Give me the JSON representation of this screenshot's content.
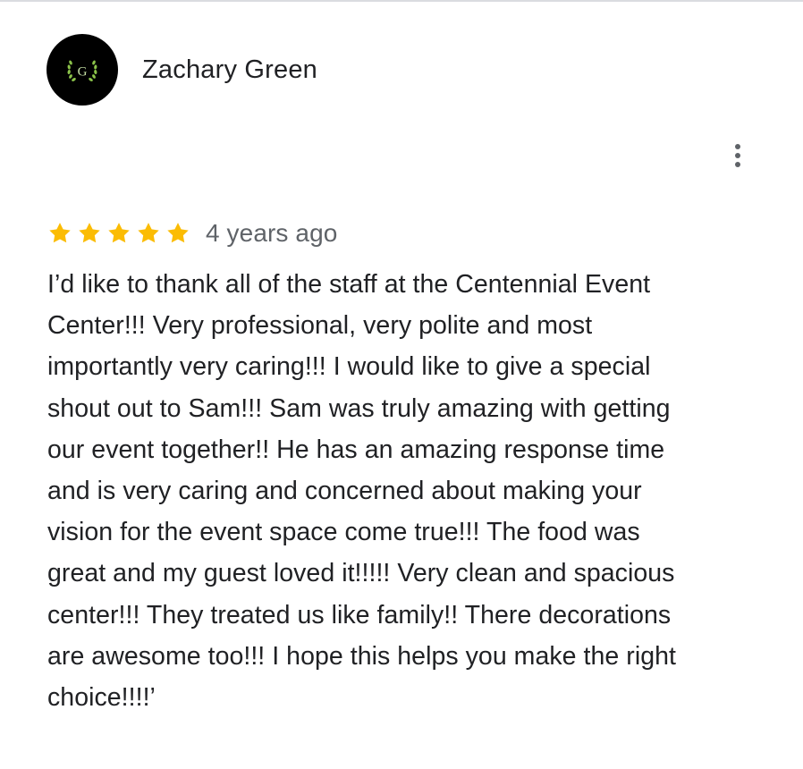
{
  "reviewer": {
    "name": "Zachary Green",
    "avatar_letter": "G",
    "avatar_bg": "#000000",
    "avatar_accent": "#8bc34a"
  },
  "menu": {
    "icon": "more-vert-icon"
  },
  "review": {
    "rating": 5,
    "rating_max": 5,
    "star_color": "#fbbc04",
    "date": "4 years ago",
    "text": "I’d like to thank all of the staff at the Centennial Event\nCenter!!! Very professional, very polite and most\nimportantly very caring!!! I would like to give a special\nshout out to Sam!!! Sam was truly amazing with getting\nour event together!! He has an amazing response time\nand is very caring and concerned about making your\nvision  for the event space come true!!! The food was\ngreat and my guest loved it!!!!! Very clean and spacious\ncenter!!! They treated us like family!! There decorations\nare awesome too!!!  I hope this helps you make the right\nchoice!!!!’"
  }
}
